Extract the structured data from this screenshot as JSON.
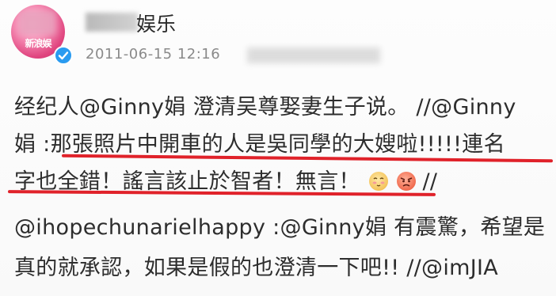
{
  "header": {
    "account_name": "娱乐",
    "avatar_logo_text": "新浪娱",
    "timestamp": "2011-06-15 12:16"
  },
  "post": {
    "lines": [
      "经纪人@Ginny娟 澄清吴尊娶妻生子说。 //@Ginny",
      "娟 :那張照片中開車的人是吳同學的大嫂啦!!!!!連名",
      "字也全錯！謠言該止於智者！無言！",
      "@ihopechunarielhappy :@Ginny娟 有震驚，希望是",
      "真的就承認，如果是假的也澄清一下吧!! //@imJIA"
    ],
    "line3_suffix": " //",
    "emojis": [
      "blushing-emoji-icon",
      "angry-emoji-icon"
    ]
  },
  "colors": {
    "underline": "#e0222a",
    "verified_badge": "#2a9bf0",
    "avatar": "#e0457f",
    "timestamp": "#8a8a8a"
  }
}
